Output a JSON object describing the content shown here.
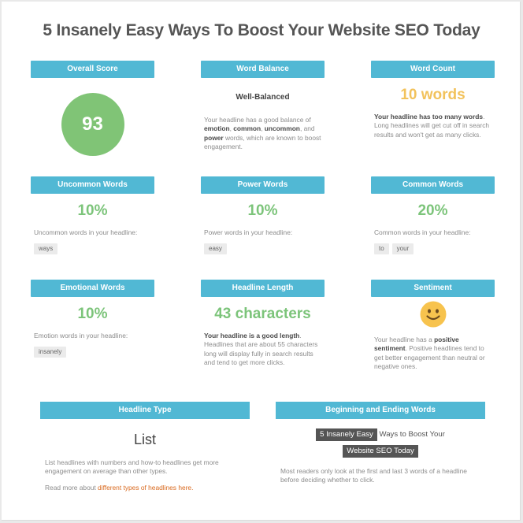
{
  "title": "5 Insanely Easy Ways To Boost Your Website SEO Today",
  "colors": {
    "header_bg": "#51b8d4",
    "score_green": "#80c476",
    "value_green": "#7cc47a",
    "value_yellow": "#f2c25b",
    "link_orange": "#d9691e",
    "highlight_dark": "#555555"
  },
  "overall_score": {
    "header": "Overall Score",
    "value": "93"
  },
  "word_balance": {
    "header": "Word Balance",
    "rating": "Well-Balanced",
    "desc": {
      "p1": "Your headline has a good balance of ",
      "b1": "emotion",
      "p2": ", ",
      "b2": "common",
      "p3": ", ",
      "b3": "uncommon",
      "p4": ", and ",
      "b4": "power",
      "p5": " words, which are known to boost engagement."
    }
  },
  "word_count": {
    "header": "Word Count",
    "value": "10 words",
    "desc_bold": "Your headline has too many words",
    "desc_rest": ". Long headlines will get cut off in search results and won't get as many clicks."
  },
  "uncommon_words": {
    "header": "Uncommon Words",
    "value": "10%",
    "label": "Uncommon words in your headline:",
    "words": [
      "ways"
    ]
  },
  "power_words": {
    "header": "Power Words",
    "value": "10%",
    "label": "Power words in your headline:",
    "words": [
      "easy"
    ]
  },
  "common_words": {
    "header": "Common Words",
    "value": "20%",
    "label": "Common words in your headline:",
    "words": [
      "to",
      "your"
    ]
  },
  "emotional_words": {
    "header": "Emotional Words",
    "value": "10%",
    "label": "Emotion words in your headline:",
    "words": [
      "insanely"
    ]
  },
  "headline_length": {
    "header": "Headline Length",
    "value": "43 characters",
    "desc_bold": "Your headline is a good length",
    "desc_rest": ". Headlines that are about 55 characters long will display fully in search results and tend to get more clicks."
  },
  "sentiment": {
    "header": "Sentiment",
    "icon": "smiley-face-icon",
    "desc_p1": "Your headline has a ",
    "desc_b1": "positive sentiment",
    "desc_p2": ". Positive headlines tend to get better engagement than neutral or negative ones."
  },
  "headline_type": {
    "header": "Headline Type",
    "value": "List",
    "desc": "List headlines with numbers and how-to headlines get more engagement on average than other types.",
    "read_more_prefix": "Read more about ",
    "read_more_link": "different types of headlines here."
  },
  "beginning_ending": {
    "header": "Beginning and Ending Words",
    "first_words": "5 Insanely Easy",
    "middle_words": "Ways to Boost Your",
    "last_words": "Website SEO Today",
    "desc": "Most readers only look at the first and last 3 words of a headline before deciding whether to click."
  }
}
